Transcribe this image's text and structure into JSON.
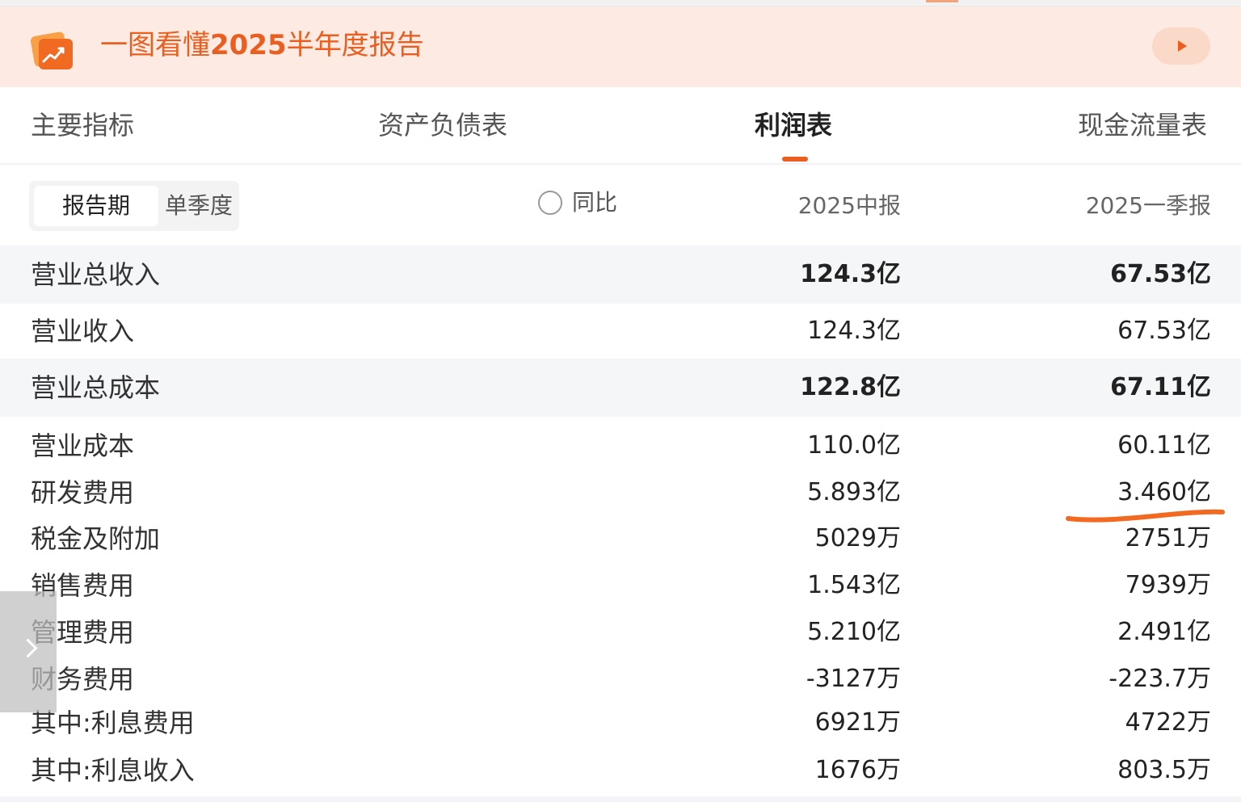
{
  "banner": {
    "title_prefix": "一图看懂",
    "title_year": "2025",
    "title_suffix": "半年度报告",
    "icon": "chart-card-icon",
    "play_icon": "play-icon",
    "accent_color": "#ea5f20"
  },
  "tabs": [
    {
      "label": "主要指标",
      "active": false
    },
    {
      "label": "资产负债表",
      "active": false
    },
    {
      "label": "利润表",
      "active": true
    },
    {
      "label": "现金流量表",
      "active": false
    }
  ],
  "filter": {
    "options": [
      "报告期",
      "单季度"
    ],
    "selected": "报告期",
    "yoy_label": "同比",
    "yoy_checked": false
  },
  "columns": [
    "2025中报",
    "2025一季报"
  ],
  "rows": [
    {
      "label": "营业总收入",
      "v1": "124.3亿",
      "v2": "67.53亿",
      "bold": true
    },
    {
      "label": "营业收入",
      "v1": "124.3亿",
      "v2": "67.53亿",
      "bold": false
    },
    {
      "label": "营业总成本",
      "v1": "122.8亿",
      "v2": "67.11亿",
      "bold": true
    },
    {
      "label": "营业成本",
      "v1": "110.0亿",
      "v2": "60.11亿",
      "bold": false
    },
    {
      "label": "研发费用",
      "v1": "5.893亿",
      "v2": "3.460亿",
      "bold": false
    },
    {
      "label": "税金及附加",
      "v1": "5029万",
      "v2": "2751万",
      "bold": false
    },
    {
      "label": "销售费用",
      "v1": "1.543亿",
      "v2": "7939万",
      "bold": false
    },
    {
      "label": "管理费用",
      "v1": "5.210亿",
      "v2": "2.491亿",
      "bold": false
    },
    {
      "label": "财务费用",
      "v1": "-3127万",
      "v2": "-223.7万",
      "bold": false
    },
    {
      "label": "其中:利息费用",
      "v1": "6921万",
      "v2": "4722万",
      "bold": false
    },
    {
      "label": "其中:利息收入",
      "v1": "1676万",
      "v2": "803.5万",
      "bold": false
    }
  ],
  "annotation": {
    "color": "#f26a21",
    "marks_row": "研发费用"
  },
  "side_tab_icon": "chevron-right-icon"
}
